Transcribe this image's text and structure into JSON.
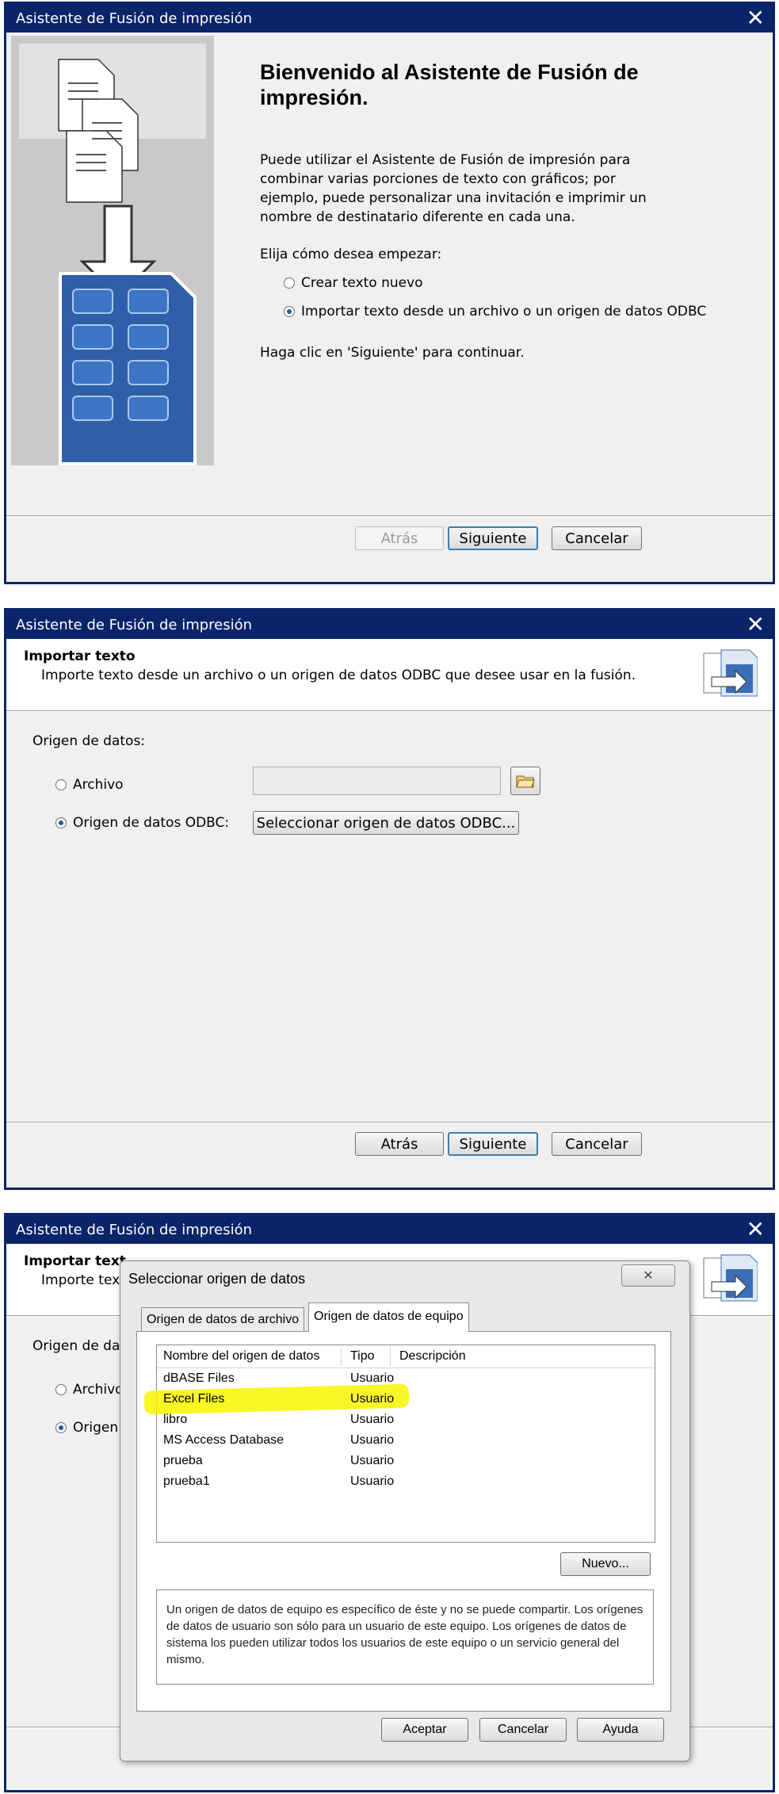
{
  "w1": {
    "title": "Asistente de Fusión de impresión",
    "heading": "Bienvenido al Asistente de Fusión de impresión.",
    "description": "Puede utilizar el Asistente de Fusión de impresión para combinar varias porciones de texto con gráficos; por ejemplo, puede personalizar una invitación e imprimir un nombre de destinatario diferente en cada una.",
    "choose_label": "Elija cómo desea empezar:",
    "option_new": "Crear texto nuevo",
    "option_import": "Importar texto desde un archivo o un origen de datos ODBC",
    "continue_hint": "Haga clic en 'Siguiente' para continuar.",
    "back": "Atrás",
    "next": "Siguiente",
    "cancel": "Cancelar",
    "selected_option": "import"
  },
  "w2": {
    "title": "Asistente de Fusión de impresión",
    "header_title": "Importar texto",
    "header_sub": "Importe texto desde un archivo o un origen de datos ODBC que desee usar en la fusión.",
    "source_label": "Origen de datos:",
    "option_file": "Archivo",
    "option_odbc": "Origen de datos ODBC:",
    "file_path": "",
    "odbc_button": "Seleccionar origen de datos ODBC...",
    "back": "Atrás",
    "next": "Siguiente",
    "cancel": "Cancelar",
    "selected_option": "odbc"
  },
  "w3": {
    "title": "Asistente de Fusión de impresión",
    "header_title_partial": "Importar text",
    "header_sub_partial": "Importe tex",
    "source_label_partial": "Origen de dat",
    "option_file_partial": "Archivo",
    "option_odbc_partial": "Origen"
  },
  "dialog": {
    "title": "Seleccionar origen de datos",
    "tabs": [
      "Origen de datos de archivo",
      "Origen de datos de equipo"
    ],
    "active_tab": 1,
    "columns": [
      "Nombre del origen de datos",
      "Tipo",
      "Descripción"
    ],
    "rows": [
      {
        "name": "dBASE Files",
        "type": "Usuario",
        "desc": ""
      },
      {
        "name": "Excel Files",
        "type": "Usuario",
        "desc": "",
        "highlighted": true
      },
      {
        "name": "libro",
        "type": "Usuario",
        "desc": ""
      },
      {
        "name": "MS Access Database",
        "type": "Usuario",
        "desc": ""
      },
      {
        "name": "prueba",
        "type": "Usuario",
        "desc": ""
      },
      {
        "name": "prueba1",
        "type": "Usuario",
        "desc": ""
      }
    ],
    "new_button": "Nuevo...",
    "info": "Un origen de datos de equipo es específico de éste y no se puede compartir. Los orígenes de datos de usuario son sólo para un usuario de este equipo. Los orígenes de datos de sistema los pueden utilizar todos los usuarios de este equipo o un servicio general del mismo.",
    "accept": "Aceptar",
    "cancel": "Cancelar",
    "help": "Ayuda",
    "highlight_color": "#f8f400"
  },
  "colors": {
    "titlebar": "#0a246a",
    "window_bg": "#f0f0f0"
  }
}
